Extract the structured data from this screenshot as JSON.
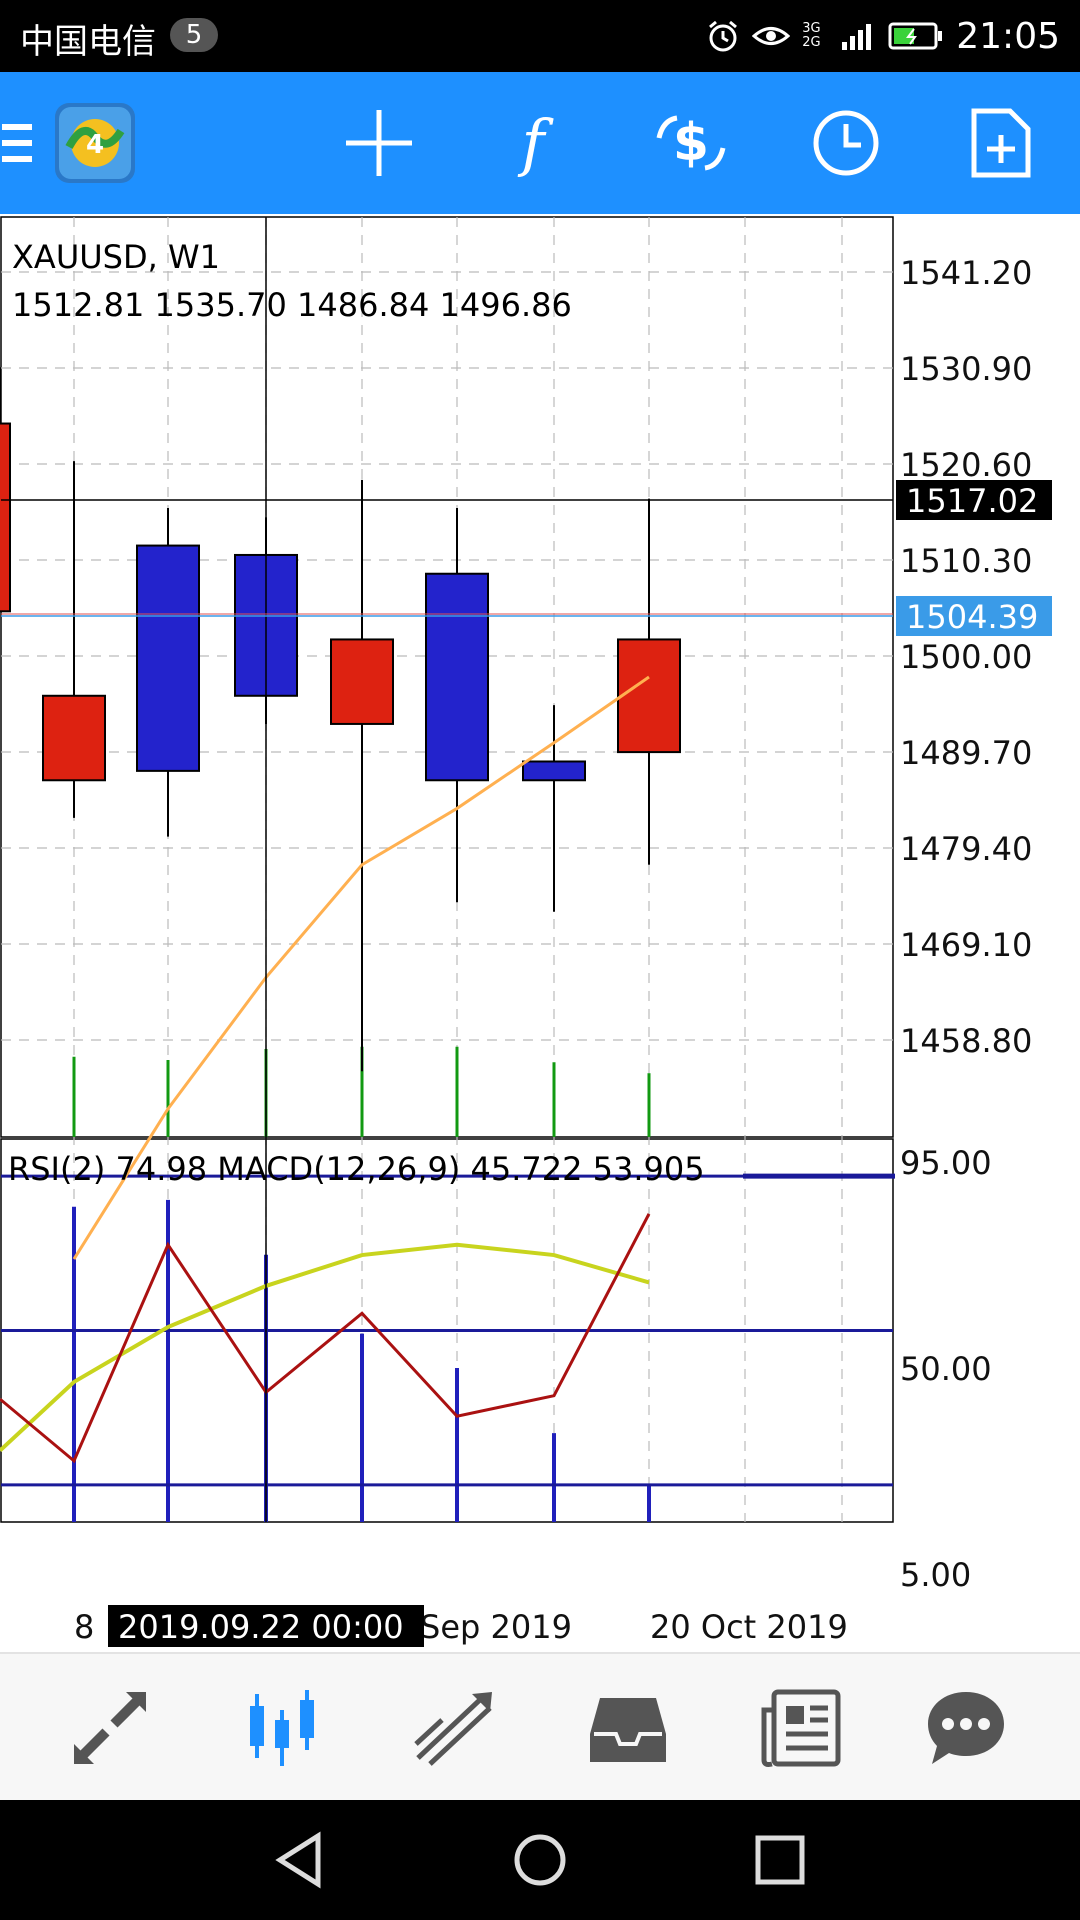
{
  "status_bar": {
    "carrier": "中国电信",
    "notification_count": "5",
    "network": "3G 2G",
    "time": "21:05",
    "icons": [
      "alarm-icon",
      "eye-icon",
      "signal-icon",
      "battery-icon"
    ]
  },
  "toolbar": {
    "icons": [
      "menu-icon",
      "metatrader-logo-icon",
      "crosshair-icon",
      "function-icon",
      "dollar-cycle-icon",
      "clock-icon",
      "new-document-icon"
    ],
    "accent_color": "#1e90ff"
  },
  "main_chart": {
    "symbol_label": "XAUUSD, W1",
    "ohlc_label": "1512.81 1535.70 1486.84 1496.86",
    "price_labels": [
      "1541.20",
      "1530.90",
      "1520.60",
      "1510.30",
      "1500.00",
      "1489.70",
      "1479.40",
      "1469.10",
      "1458.80"
    ],
    "crosshair_price": "1517.02",
    "bid_price": "1504.39",
    "bull_color": "#2323cc",
    "bear_color": "#dd2211",
    "ma_color": "#ffb050"
  },
  "indicator": {
    "label": "RSI(2) 74.98 MACD(12,26,9) 45.722 53.905",
    "levels": [
      "95.00",
      "50.00",
      "5.00"
    ],
    "rsi_color": "#aa1111",
    "signal_color": "#c8d41e",
    "histogram_color": "#2020bb"
  },
  "time_axis": {
    "labels": [
      "8",
      "Sep 2019",
      "20 Oct 2019"
    ],
    "crosshair_time": "2019.09.22 00:00"
  },
  "chart_data": {
    "type": "candlestick",
    "title": "XAUUSD, W1",
    "ylim": [
      1450,
      1548
    ],
    "candles": [
      {
        "open": 1526,
        "high": 1532,
        "low": 1506,
        "close": 1506
      },
      {
        "open": 1497,
        "high": 1522,
        "low": 1484,
        "close": 1488
      },
      {
        "open": 1489,
        "high": 1517,
        "low": 1482,
        "close": 1513
      },
      {
        "open": 1497,
        "high": 1516,
        "low": 1494,
        "close": 1512
      },
      {
        "open": 1503,
        "high": 1520,
        "low": 1457,
        "close": 1494
      },
      {
        "open": 1488,
        "high": 1517,
        "low": 1475,
        "close": 1510
      },
      {
        "open": 1488,
        "high": 1496,
        "low": 1474,
        "close": 1490
      },
      {
        "open": 1503,
        "high": 1518,
        "low": 1479,
        "close": 1491
      }
    ],
    "moving_average": [
      null,
      1437,
      1453,
      1467,
      1479,
      1485,
      1492,
      1499
    ],
    "volume_ratio": [
      0,
      0.73,
      0.7,
      0.8,
      0.82,
      0.82,
      0.68,
      0.58
    ],
    "oscillator": {
      "ylim": [
        0,
        100
      ],
      "rsi": [
        30,
        12,
        75,
        32,
        55,
        25,
        31,
        84
      ],
      "signal": [
        15,
        35,
        51,
        63,
        72,
        75,
        72,
        64
      ],
      "histogram": [
        null,
        89,
        91,
        75,
        52,
        42,
        23,
        8
      ]
    }
  },
  "bottom_nav": {
    "items": [
      "quotes-icon",
      "charts-icon",
      "trade-icon",
      "history-icon",
      "news-icon",
      "messages-icon"
    ],
    "active": "charts-icon",
    "active_color": "#1e90ff",
    "inactive_color": "#555555"
  },
  "system_nav": {
    "buttons": [
      "back-button",
      "home-button",
      "recents-button"
    ]
  }
}
